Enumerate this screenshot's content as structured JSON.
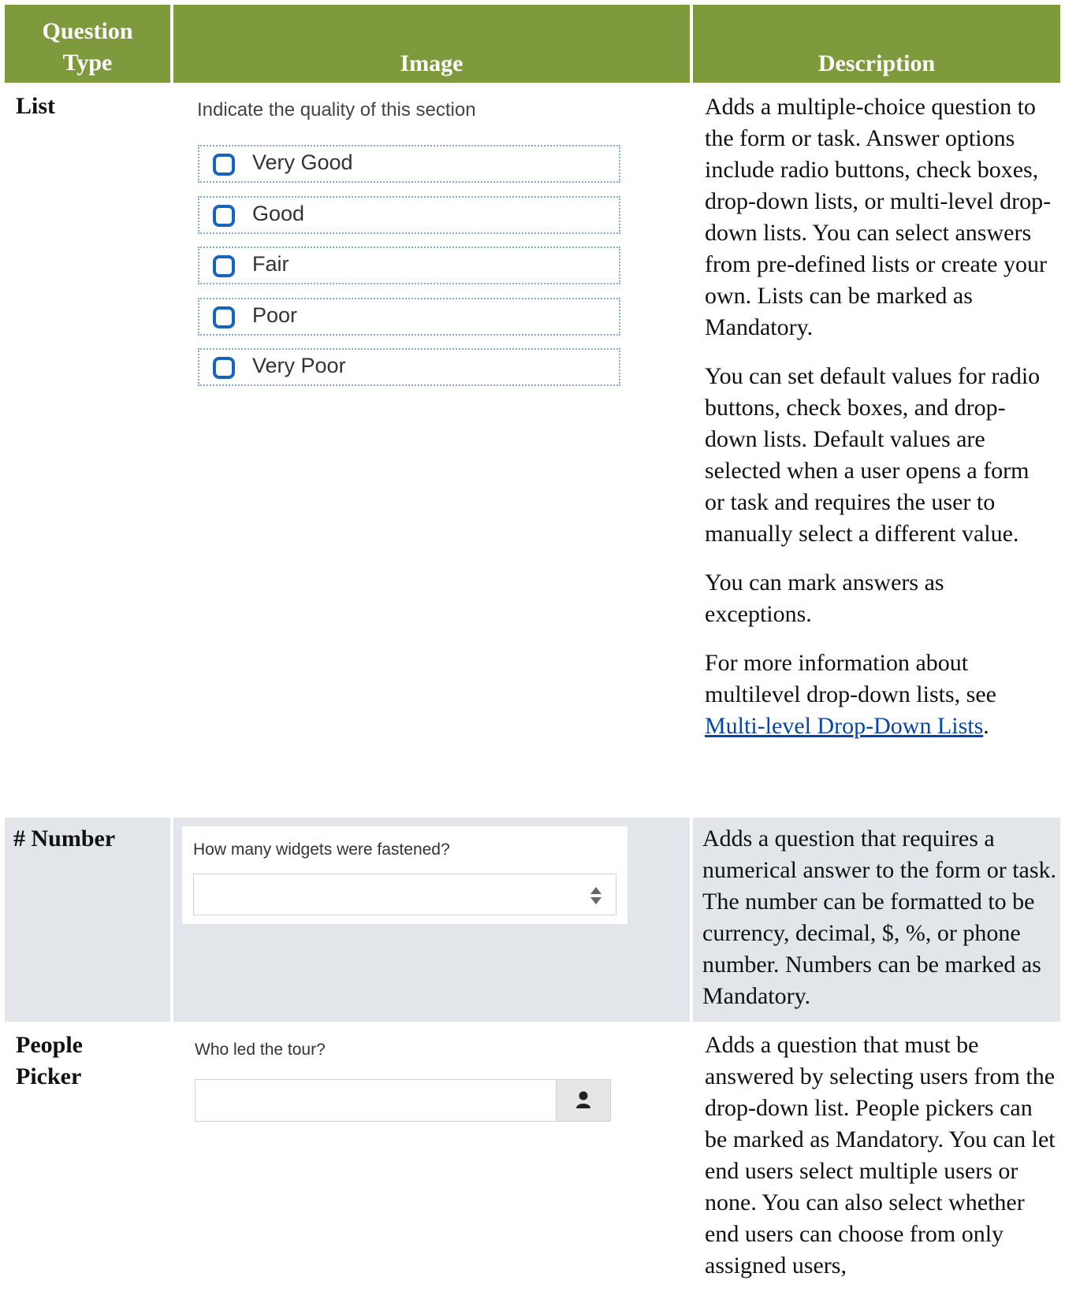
{
  "header": {
    "col1_line1": "Question",
    "col1_line2": "Type",
    "col2": "Image",
    "col3": "Description"
  },
  "rows": {
    "list": {
      "type": "List",
      "image": {
        "prompt": "Indicate the quality of this section",
        "options": [
          "Very Good",
          "Good",
          "Fair",
          "Poor",
          "Very Poor"
        ]
      },
      "desc_p1": "Adds a multiple-choice question to the form or task. Answer options include radio buttons, check boxes, drop-down lists, or multi-level drop-down lists. You can select answers from pre-defined lists or create your own. Lists can be marked as Mandatory.",
      "desc_p2": "You can set default values for radio buttons, check boxes, and drop-down lists. Default values are selected when a user opens a form or task and requires the user to manually select a different value.",
      "desc_p3": "You can mark answers as exceptions.",
      "desc_p4_text": "For more information about multilevel drop-down lists, see ",
      "desc_p4_link": "Multi-level Drop-Down Lists",
      "desc_p4_end": "."
    },
    "number": {
      "type": "# Number",
      "image": {
        "prompt": "How many widgets were fastened?",
        "value": ""
      },
      "desc": "Adds a question that requires a numerical answer to the form or task. The number can be formatted to be currency, decimal, $, %, or phone number. Numbers can be marked as Mandatory."
    },
    "people": {
      "type_line1": "People",
      "type_line2": "Picker",
      "image": {
        "prompt": "Who led the tour?",
        "value": "",
        "icon": "user-icon"
      },
      "desc": "Adds a question that must be answered by selecting users from the drop-down list. People pickers can be marked as Mandatory. You can let end users select multiple users or none. You can also select whether end users can choose from only assigned users,"
    }
  },
  "colors": {
    "header_bg": "#7f9a3d",
    "row_gray": "#e2e6ea",
    "radio_blue": "#1565c0",
    "link": "#0645ad"
  }
}
